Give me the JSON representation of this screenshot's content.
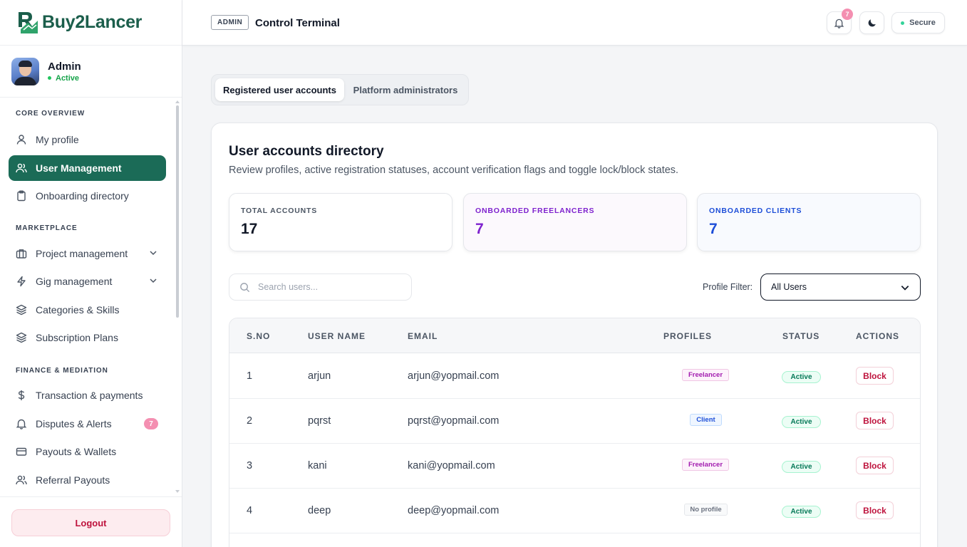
{
  "brand": {
    "name": "Buy2Lancer",
    "color": "#1b5e4b",
    "accent": "#1b6b57"
  },
  "user": {
    "name": "Admin",
    "status": "Active"
  },
  "nav": {
    "sections": [
      {
        "title": "CORE OVERVIEW"
      },
      {
        "title": "MARKETPLACE"
      },
      {
        "title": "FINANCE & MEDIATION"
      }
    ],
    "items": [
      {
        "label": "My profile",
        "icon": "user-icon"
      },
      {
        "label": "User Management",
        "icon": "users-icon",
        "active": true
      },
      {
        "label": "Onboarding directory",
        "icon": "clipboard-icon"
      },
      {
        "label": "Project management",
        "icon": "briefcase-icon",
        "expandable": true
      },
      {
        "label": "Gig management",
        "icon": "bolt-icon",
        "expandable": true
      },
      {
        "label": "Categories & Skills",
        "icon": "layers-icon"
      },
      {
        "label": "Subscription Plans",
        "icon": "layers-icon"
      },
      {
        "label": "Transaction & payments",
        "icon": "dollar-icon"
      },
      {
        "label": "Disputes & Alerts",
        "icon": "bell-icon",
        "badge": "7"
      },
      {
        "label": "Payouts & Wallets",
        "icon": "card-icon"
      },
      {
        "label": "Referral Payouts",
        "icon": "users-icon"
      }
    ],
    "logout": "Logout"
  },
  "header": {
    "tag": "ADMIN",
    "title": "Control Terminal",
    "notifications": "7",
    "secure": "Secure"
  },
  "tabs": [
    {
      "label": "Registered user accounts",
      "active": true
    },
    {
      "label": "Platform administrators",
      "active": false
    }
  ],
  "directory": {
    "title": "User accounts directory",
    "subtitle": "Review profiles, active registration statuses, account verification flags and toggle lock/block states.",
    "stats": [
      {
        "label": "TOTAL ACCOUNTS",
        "value": "17",
        "color": "#111827"
      },
      {
        "label": "ONBOARDED FREELANCERS",
        "value": "7",
        "color": "#7e22ce"
      },
      {
        "label": "ONBOARDED CLIENTS",
        "value": "7",
        "color": "#1d4ed8"
      }
    ],
    "search_placeholder": "Search users...",
    "filter_label": "Profile Filter:",
    "filter_value": "All Users"
  },
  "table": {
    "columns": [
      "S.NO",
      "USER NAME",
      "EMAIL",
      "PROFILES",
      "STATUS",
      "ACTIONS"
    ],
    "rows": [
      {
        "sno": "1",
        "name": "arjun",
        "email": "arjun@yopmail.com",
        "profile": "Freelancer",
        "status": "Active",
        "action": "Block"
      },
      {
        "sno": "2",
        "name": "pqrst",
        "email": "pqrst@yopmail.com",
        "profile": "Client",
        "status": "Active",
        "action": "Block"
      },
      {
        "sno": "3",
        "name": "kani",
        "email": "kani@yopmail.com",
        "profile": "Freelancer",
        "status": "Active",
        "action": "Block"
      },
      {
        "sno": "4",
        "name": "deep",
        "email": "deep@yopmail.com",
        "profile": "No profile",
        "status": "Active",
        "action": "Block"
      }
    ]
  }
}
